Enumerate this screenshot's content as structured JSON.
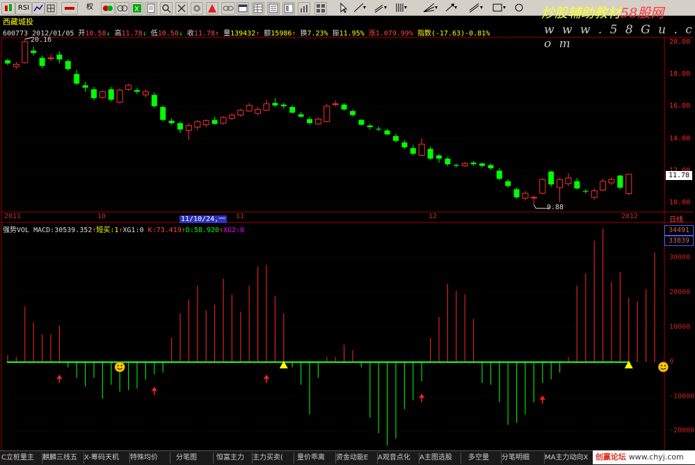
{
  "toolbar": {
    "items": [
      "K",
      "RSI",
      "",
      "",
      "权",
      "",
      "",
      "",
      "",
      "",
      "",
      "",
      "",
      "",
      "",
      "",
      "",
      "",
      "",
      "",
      "",
      "",
      "",
      "",
      "",
      ""
    ]
  },
  "brand": {
    "title": "炒股辅助教材",
    "suffix": "58股网",
    "url": "w w w . 5 8 G u . c o m"
  },
  "stock": {
    "name": "西藏城投",
    "code": "600773",
    "date": "2012/01/05",
    "open_label": "开",
    "open": "10.58",
    "high_label": "高",
    "high": "11.78",
    "low_label": "低",
    "low": "10.50",
    "close_label": "收",
    "close": "11.78",
    "vol_label": "量",
    "vol": "139432",
    "amount_label": "额",
    "amount": "15986",
    "turnover_label": "换",
    "turnover": "7.23%",
    "amplitude_label": "振",
    "amplitude": "11.95%",
    "change_label": "涨",
    "change": "1.07",
    "change_pct": "9.99%",
    "index_label": "指数",
    "index": "(-17.63)-0.81%"
  },
  "price_axis": {
    "labels": [
      "20.00",
      "18.00",
      "16.00",
      "14.00",
      "12.00",
      "10.00"
    ],
    "current": "11.78",
    "max_note": "20.16",
    "min_note": "9.88",
    "period": "日线"
  },
  "time_axis": {
    "labels": [
      "2011",
      "10",
      "11/10/24,一",
      "11",
      "12",
      "2012"
    ]
  },
  "indicator": {
    "name": "强势VOL",
    "macd_label": "MACD:",
    "macd": "30539.352",
    "short_buy_label": "短买:",
    "short_buy": "1",
    "xg1_label": "XG1:",
    "xg1": "0",
    "k_label": "K:",
    "k": "73.419",
    "d_label": "D:",
    "d": "58.920",
    "xg2_label": "XG2:",
    "xg2": "0",
    "axis_top1": "34491",
    "axis_top2": "33839",
    "axis_labels": [
      "30000",
      "20000",
      "10000",
      "0",
      "-10000",
      "-20000"
    ]
  },
  "tabs": [
    "C立桩量主",
    "麒麟三线五",
    "X-筹码天机",
    "特殊均价",
    "分笔图",
    "恒富主力",
    "主力买卖(",
    "量价乖离",
    "资金动能E",
    "A观音点化",
    "A主图选股",
    "多空量",
    "分笔明细",
    "MA主力动向X"
  ],
  "watermark": {
    "a": "创赢论坛",
    "b": "www.chyj.com"
  },
  "chart_data": [
    {
      "type": "candlestick",
      "title": "西藏城投 日线",
      "ylim": [
        9.5,
        20.2
      ],
      "y_ticks": [
        10,
        12,
        14,
        16,
        18,
        20
      ],
      "max_note": 20.16,
      "min_note": 9.88,
      "ohlc": [
        [
          18.85,
          18.65,
          18.95,
          18.55
        ],
        [
          18.45,
          18.6,
          18.75,
          18.3
        ],
        [
          18.7,
          20.0,
          20.16,
          18.65
        ],
        [
          19.45,
          19.3,
          19.7,
          19.15
        ],
        [
          19.0,
          18.5,
          19.15,
          18.35
        ],
        [
          18.95,
          19.0,
          19.2,
          18.8
        ],
        [
          19.2,
          18.9,
          19.4,
          18.65
        ],
        [
          18.8,
          18.3,
          18.9,
          18.2
        ],
        [
          18.0,
          17.4,
          18.25,
          17.3
        ],
        [
          17.3,
          17.15,
          17.5,
          16.9
        ],
        [
          17.05,
          16.5,
          17.2,
          16.35
        ],
        [
          16.55,
          16.9,
          17.0,
          16.45
        ],
        [
          17.05,
          16.4,
          17.2,
          16.3
        ],
        [
          16.25,
          17.0,
          17.1,
          16.15
        ],
        [
          17.05,
          17.3,
          17.4,
          16.95
        ],
        [
          17.0,
          16.9,
          17.15,
          16.75
        ],
        [
          16.7,
          16.9,
          17.05,
          16.55
        ],
        [
          16.7,
          16.0,
          16.85,
          15.9
        ],
        [
          15.95,
          15.15,
          16.05,
          15.05
        ],
        [
          15.1,
          14.95,
          15.25,
          14.85
        ],
        [
          14.95,
          14.55,
          15.05,
          14.35
        ],
        [
          14.5,
          14.8,
          14.95,
          13.9
        ],
        [
          14.7,
          15.05,
          15.15,
          14.5
        ],
        [
          14.85,
          15.1,
          15.2,
          14.7
        ],
        [
          15.15,
          14.9,
          15.35,
          14.85
        ],
        [
          14.95,
          15.3,
          15.4,
          14.85
        ],
        [
          15.25,
          15.45,
          15.55,
          15.15
        ],
        [
          15.45,
          15.75,
          15.85,
          15.35
        ],
        [
          15.7,
          16.05,
          16.2,
          15.65
        ],
        [
          15.55,
          15.8,
          15.95,
          15.45
        ],
        [
          15.75,
          16.15,
          16.4,
          15.7
        ],
        [
          16.2,
          16.05,
          16.5,
          15.95
        ],
        [
          16.1,
          16.0,
          16.2,
          15.85
        ],
        [
          15.95,
          15.6,
          16.05,
          15.55
        ],
        [
          15.5,
          15.35,
          15.65,
          15.3
        ],
        [
          15.2,
          14.95,
          15.35,
          14.85
        ],
        [
          14.9,
          15.2,
          15.3,
          14.85
        ],
        [
          15.05,
          16.0,
          16.15,
          15.0
        ],
        [
          16.15,
          16.15,
          16.35,
          16.0
        ],
        [
          16.1,
          15.8,
          16.2,
          15.7
        ],
        [
          15.7,
          15.45,
          15.8,
          15.35
        ],
        [
          15.15,
          14.85,
          15.2,
          14.8
        ],
        [
          14.8,
          14.7,
          14.9,
          14.55
        ],
        [
          14.6,
          14.55,
          14.75,
          14.45
        ],
        [
          14.5,
          14.25,
          14.6,
          14.2
        ],
        [
          14.15,
          13.85,
          14.3,
          13.75
        ],
        [
          13.75,
          13.45,
          13.9,
          13.35
        ],
        [
          13.4,
          13.05,
          13.6,
          12.95
        ],
        [
          12.95,
          13.65,
          14.0,
          12.9
        ],
        [
          13.35,
          12.75,
          13.5,
          12.65
        ],
        [
          12.95,
          12.75,
          13.05,
          12.5
        ],
        [
          12.75,
          12.4,
          12.85,
          12.3
        ],
        [
          12.35,
          12.3,
          12.45,
          12.2
        ],
        [
          12.3,
          12.45,
          12.55,
          12.25
        ],
        [
          12.5,
          12.4,
          12.6,
          12.3
        ],
        [
          12.45,
          12.3,
          12.5,
          12.2
        ],
        [
          12.35,
          12.15,
          12.45,
          12.05
        ],
        [
          12.0,
          11.5,
          12.15,
          11.4
        ],
        [
          11.35,
          11.05,
          11.5,
          10.95
        ],
        [
          10.85,
          10.35,
          10.95,
          10.25
        ],
        [
          10.3,
          10.6,
          10.75,
          10.15
        ],
        [
          10.35,
          10.35,
          10.45,
          9.88
        ],
        [
          10.6,
          11.45,
          11.55,
          10.55
        ],
        [
          11.95,
          11.15,
          12.0,
          11.0
        ],
        [
          10.95,
          11.45,
          11.55,
          10.05
        ],
        [
          11.2,
          11.55,
          11.85,
          11.05
        ],
        [
          11.35,
          10.9,
          11.55,
          10.85
        ],
        [
          10.75,
          10.7,
          10.85,
          10.6
        ],
        [
          10.35,
          10.75,
          10.9,
          10.2
        ],
        [
          10.8,
          11.35,
          11.5,
          10.75
        ],
        [
          11.25,
          11.45,
          11.6,
          11.1
        ],
        [
          11.7,
          10.95,
          11.75,
          10.85
        ],
        [
          10.58,
          11.78,
          11.78,
          10.5
        ]
      ]
    },
    {
      "type": "bar",
      "title": "强势VOL",
      "ylim": [
        -25000,
        37000
      ],
      "y_ticks": [
        30000,
        20000,
        10000,
        0,
        -10000,
        -20000
      ],
      "values": [
        2000,
        1500,
        16000,
        11500,
        8000,
        8000,
        10500,
        -1500,
        -4500,
        -7000,
        -4500,
        -10500,
        -6500,
        -8500,
        -8000,
        -7500,
        -5000,
        -3500,
        -3000,
        7000,
        14000,
        18000,
        22000,
        15000,
        16500,
        24000,
        19500,
        14500,
        22000,
        27500,
        28000,
        19000,
        14000,
        -1500,
        -6500,
        -15000,
        -4500,
        1500,
        1500,
        5000,
        3500,
        -1500,
        -16000,
        -20500,
        -24000,
        -22000,
        -13500,
        -11000,
        -5500,
        7000,
        13000,
        22500,
        20500,
        19500,
        12500,
        -6000,
        -6500,
        -11500,
        -18000,
        -17500,
        -15000,
        -11500,
        -6000,
        -5000,
        -3000,
        1500,
        22000,
        25500,
        35000,
        38500,
        23000,
        26000,
        18500,
        17500,
        21000,
        31500
      ],
      "short_buy_markers": [
        6,
        17,
        30,
        48,
        62
      ],
      "triangle_markers": [
        32,
        72
      ],
      "smiley_markers": [
        13,
        76
      ]
    }
  ]
}
